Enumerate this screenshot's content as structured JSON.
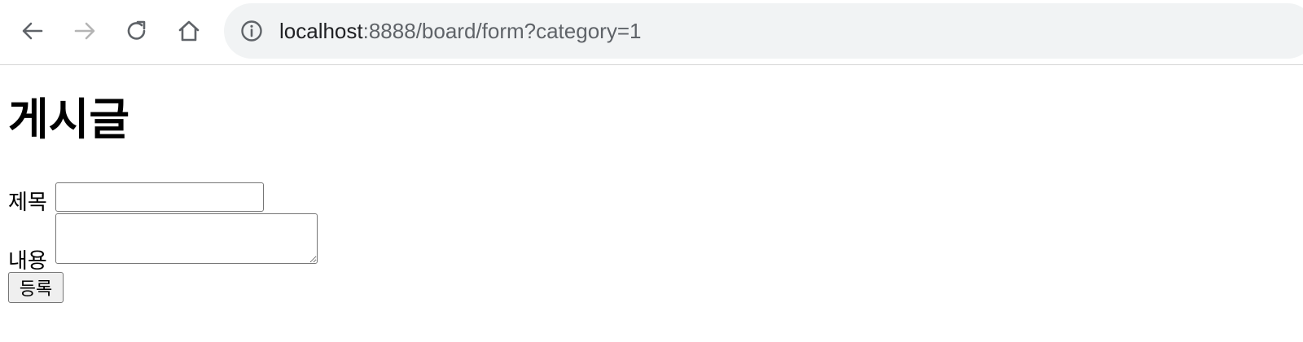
{
  "browser": {
    "url_host": "localhost",
    "url_rest": ":8888/board/form?category=1",
    "icons": {
      "back": "arrow-left-icon",
      "forward": "arrow-right-icon",
      "reload": "reload-icon",
      "home": "home-icon",
      "site_info": "info-icon"
    },
    "colors": {
      "omnibox_bg": "#f1f3f4",
      "forward_disabled": "#b5b5b5",
      "icon": "#5f6368"
    }
  },
  "page": {
    "title": "게시글",
    "form": {
      "title_label": "제목",
      "title_value": "",
      "content_label": "내용",
      "content_value": "",
      "submit_label": "등록"
    }
  }
}
